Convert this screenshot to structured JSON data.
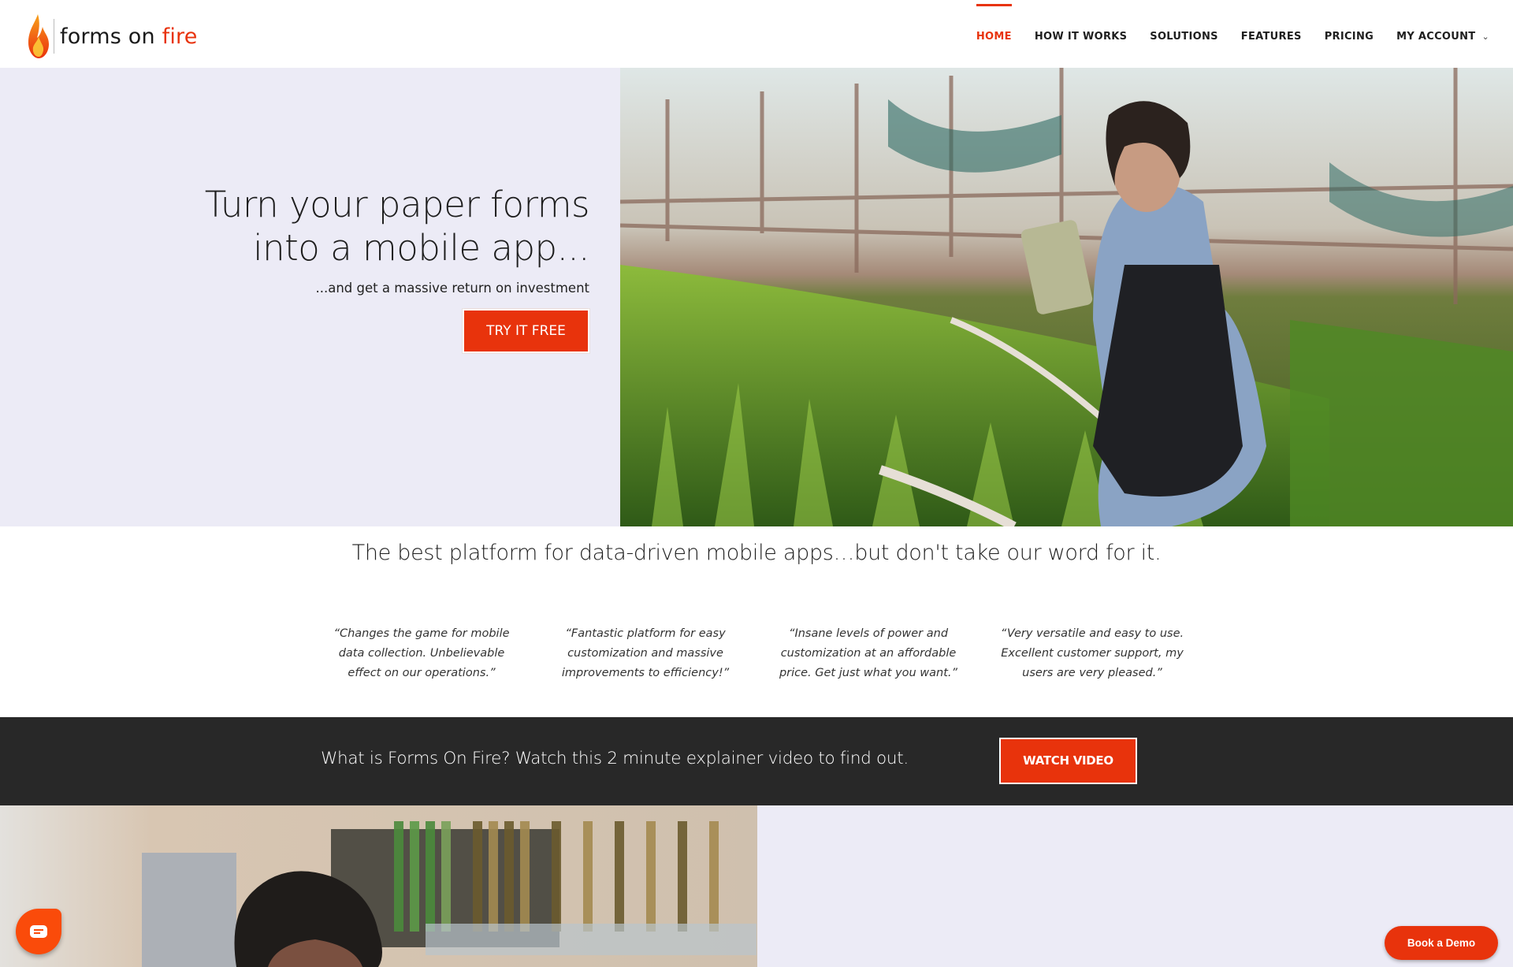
{
  "brand": {
    "logo_icon": "flame-icon",
    "name_part1": "forms on ",
    "name_part2": "fire",
    "accent_color": "#e8330c"
  },
  "nav": {
    "items": [
      {
        "label": "HOME",
        "active": true
      },
      {
        "label": "HOW IT WORKS",
        "active": false
      },
      {
        "label": "SOLUTIONS",
        "active": false
      },
      {
        "label": "FEATURES",
        "active": false
      },
      {
        "label": "PRICING",
        "active": false
      },
      {
        "label": "MY ACCOUNT",
        "active": false,
        "has_dropdown": true,
        "icon": "chevron-down-icon"
      }
    ]
  },
  "hero": {
    "title_line1": "Turn your paper forms",
    "title_line2": "into a mobile app...",
    "subtitle": "...and get a massive return on investment",
    "cta_label": "TRY IT FREE",
    "image_description": "Smiling woman in a greenhouse using a tablet among tulip seedlings"
  },
  "testimonials": {
    "heading": "The best platform for data-driven mobile apps…but don't take our word for it.",
    "quotes": [
      {
        "line1": "“Changes the game for mobile",
        "line2": "data collection. Unbelievable",
        "line3": "effect on our operations.”"
      },
      {
        "line1": "“Fantastic platform for easy",
        "line2": "customization and massive",
        "line3": "improvements to efficiency!”"
      },
      {
        "line1": "“Insane levels of power and",
        "line2": "customization at an affordable",
        "line3": "price. Get just what you want.”"
      },
      {
        "line1": "“Very versatile and easy to use.",
        "line2": "Excellent customer support, my",
        "line3": "users are very pleased.”"
      }
    ]
  },
  "video_band": {
    "text": "What is Forms On Fire? Watch this 2 minute explainer video to find out.",
    "button_label": "WATCH VIDEO"
  },
  "bottom": {
    "image_description": "Blurred shop shelves with a person with curly hair in foreground"
  },
  "floating": {
    "chat_icon": "chat-icon",
    "demo_label": "Book a Demo"
  }
}
